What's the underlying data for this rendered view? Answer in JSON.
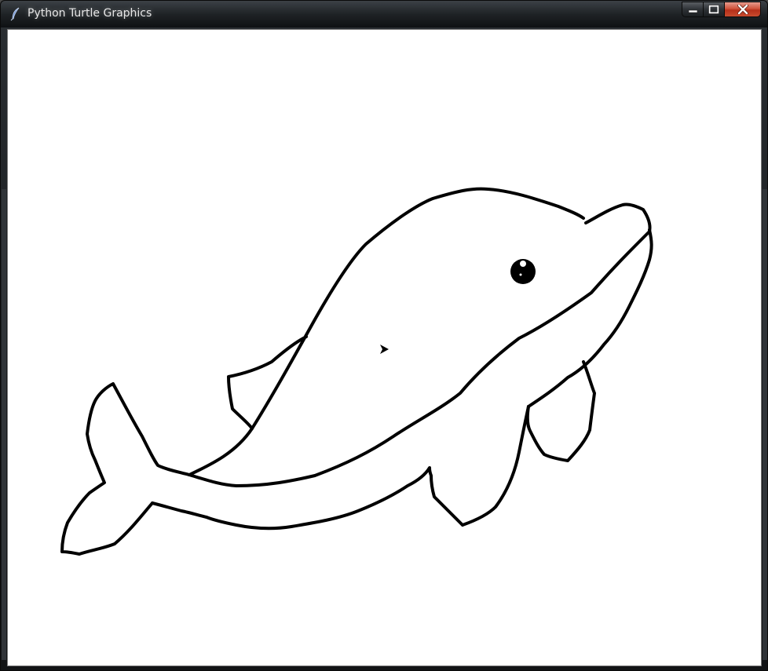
{
  "window": {
    "title": "Python Turtle Graphics",
    "icons": {
      "app": "feather-icon",
      "minimize": "minimize-icon",
      "maximize": "maximize-icon",
      "close": "close-icon"
    }
  },
  "canvas": {
    "background": "#ffffff",
    "pen_color": "#000000",
    "drawing": "dolphin",
    "cursor": "turtle-arrow-icon"
  },
  "colors": {
    "close_button": "#c7452c",
    "title_text": "#e8e8e8"
  }
}
